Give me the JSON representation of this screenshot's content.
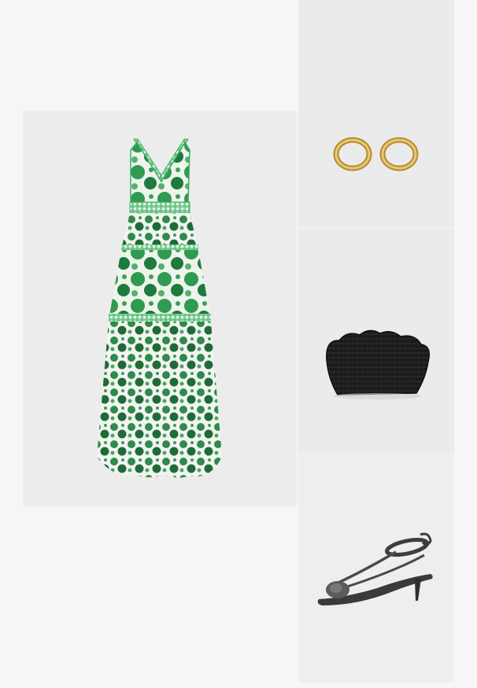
{
  "outfit": {
    "items": [
      {
        "name": "dress",
        "icon": "floral-maxi-dress-icon",
        "color": "#2e8b4e"
      },
      {
        "name": "earrings",
        "icon": "gold-hoop-earrings-icon",
        "color": "#c9a24a"
      },
      {
        "name": "bag",
        "icon": "woven-shell-clutch-icon",
        "color": "#1c1c1c"
      },
      {
        "name": "shoes",
        "icon": "strappy-kitten-heel-sandal-icon",
        "color": "#4a4a4a"
      }
    ]
  }
}
